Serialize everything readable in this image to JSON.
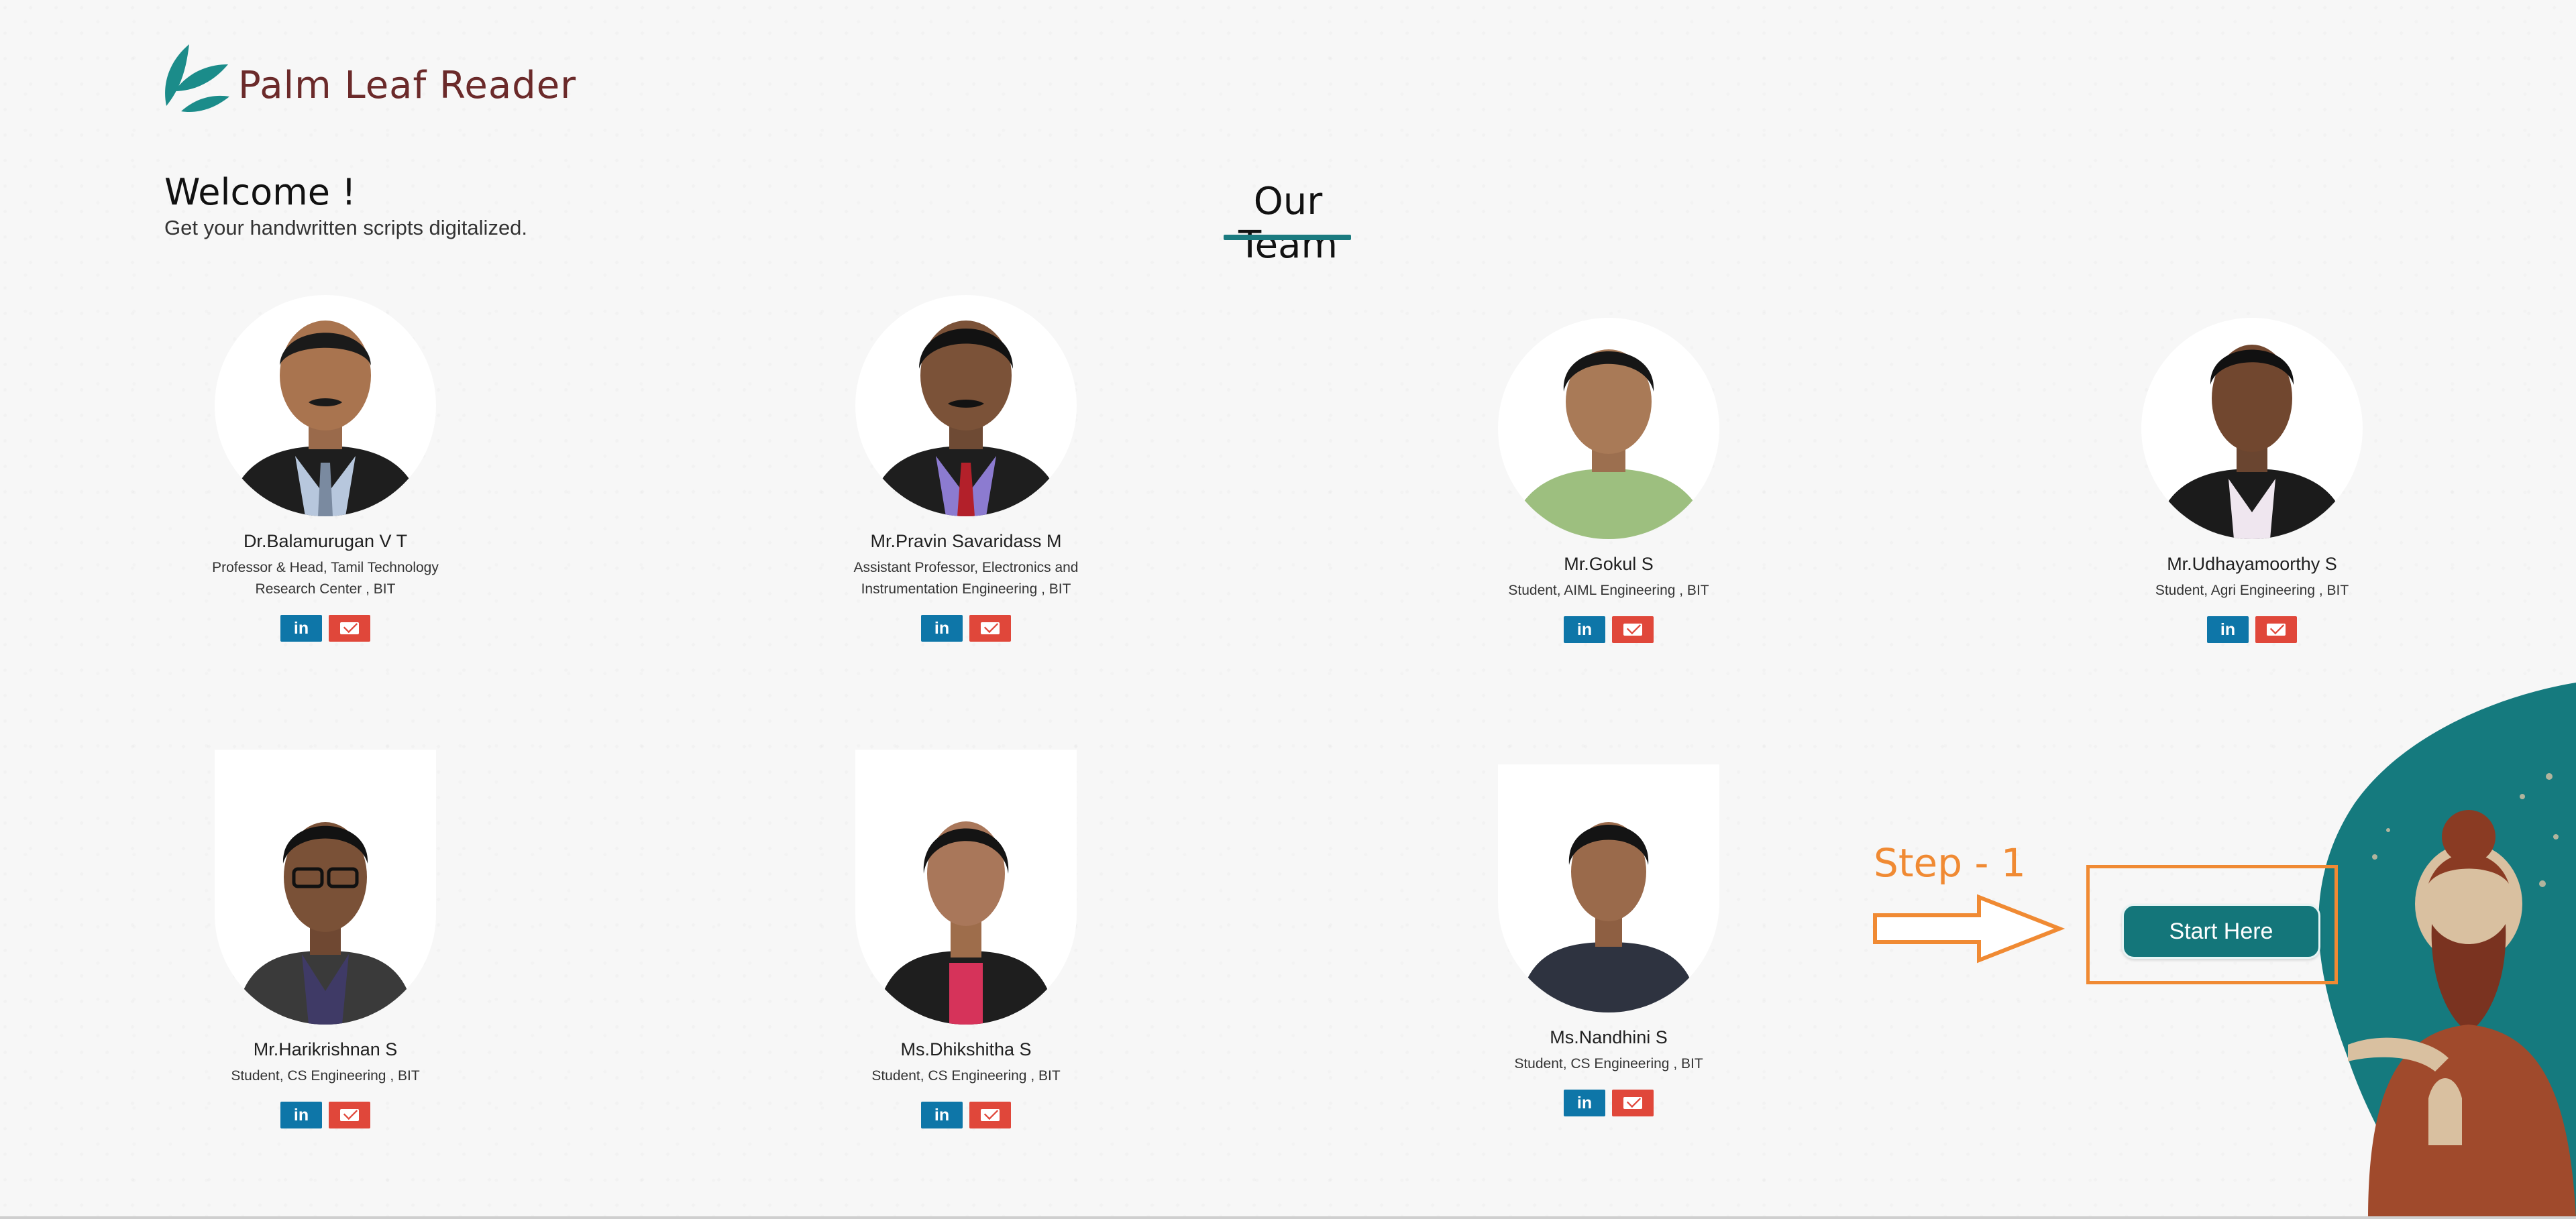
{
  "brand": {
    "name": "Palm Leaf Reader",
    "logo_icon": "leaf-icon",
    "color": "#6b2a2a"
  },
  "welcome": {
    "title": "Welcome !",
    "subtitle": "Get your handwritten scripts digitalized."
  },
  "team": {
    "title": "Our Team",
    "accent": "#1b7b80",
    "members": [
      {
        "name": "Dr.Balamurugan V T",
        "role": "Professor & Head, Tamil Technology Research Center , BIT",
        "shirt": "#b7c7dd",
        "tie": "#7a8aa0"
      },
      {
        "name": "Mr.Pravin Savaridass M",
        "role": "Assistant Professor, Electronics and Instrumentation Engineering , BIT",
        "shirt": "#8c7bd0",
        "tie": "#b3202a"
      },
      {
        "name": "Mr.Gokul S",
        "role": "Student, AIML Engineering , BIT",
        "shirt": "#9dbf7f"
      },
      {
        "name": "Mr.Udhayamoorthy S",
        "role": "Student, Agri Engineering , BIT",
        "shirt": "#efe6ef"
      },
      {
        "name": "Mr.Harikrishnan S",
        "role": "Student, CS Engineering , BIT",
        "shirt": "#3f3a66"
      },
      {
        "name": "Ms.Dhikshitha S",
        "role": "Student, CS Engineering , BIT",
        "shirt": "#d6335a"
      },
      {
        "name": "Ms.Nandhini S",
        "role": "Student, CS Engineering , BIT",
        "shirt": "#2e3340"
      }
    ],
    "social": {
      "linkedin_label": "in",
      "linkedin_icon": "linkedin-icon",
      "email_icon": "email-icon"
    }
  },
  "cta": {
    "step_label": "Step - 1",
    "button_label": "Start Here",
    "highlight_color": "#f08a33",
    "button_color": "#14767a"
  }
}
